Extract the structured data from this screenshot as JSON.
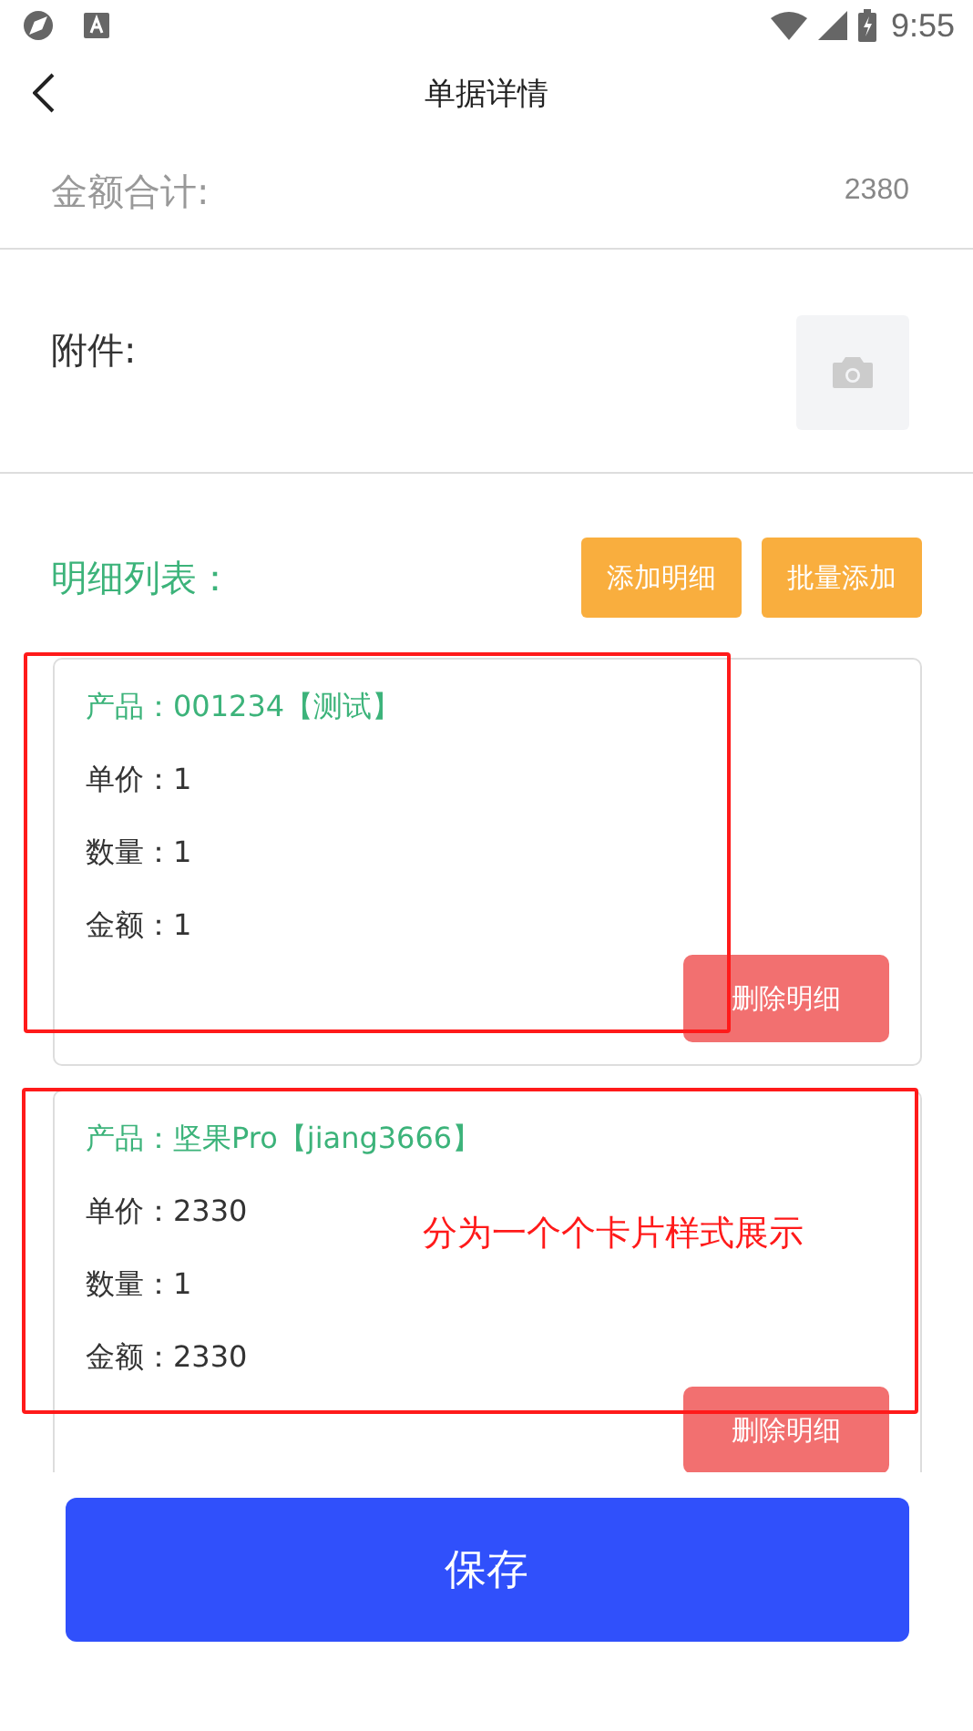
{
  "status_bar": {
    "time": "9:55"
  },
  "header": {
    "title": "单据详情"
  },
  "total": {
    "label": "金额合计:",
    "value": "2380"
  },
  "attachment": {
    "label": "附件:"
  },
  "details": {
    "title": "明细列表：",
    "buttons": [
      "添加明细",
      "批量添加"
    ],
    "items": [
      {
        "title": "产品：001234【测试】",
        "lines": [
          "单价：1",
          "数量：1",
          "金额：1"
        ],
        "button": "删除明细"
      },
      {
        "title": "产品：坚果Pro【jiang3666】",
        "lines": [
          "单价：2330",
          "数量：1",
          "金额：2330"
        ],
        "button": "删除明细"
      }
    ]
  },
  "annotation": {
    "note": "分为一个个卡片样式展示"
  },
  "save_button": "保存"
}
